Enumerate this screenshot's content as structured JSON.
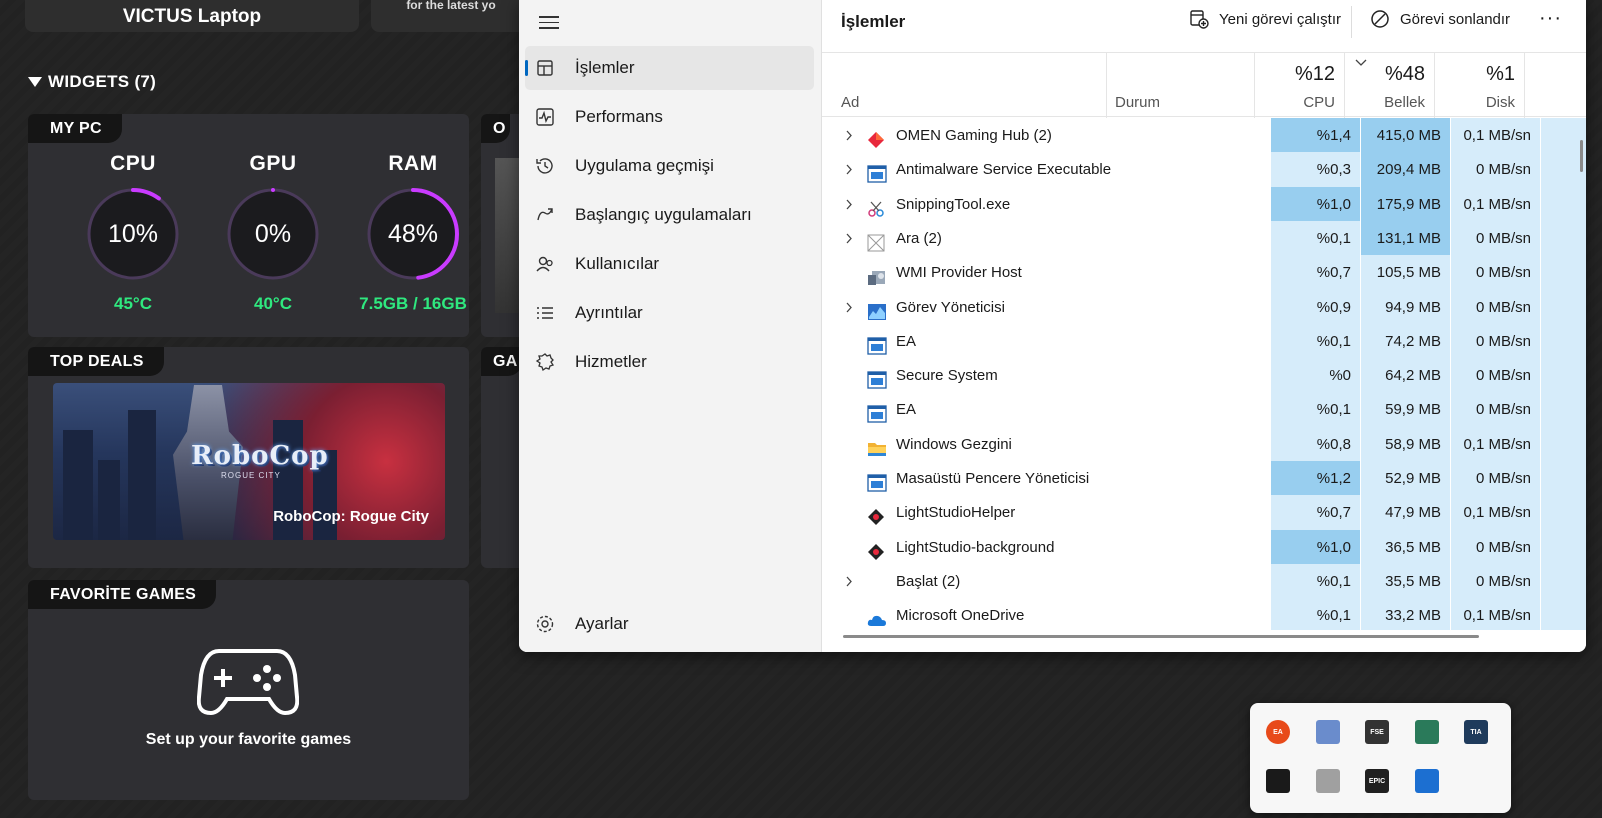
{
  "omen": {
    "device_name": "VICTUS Laptop",
    "promo_text": "for the latest yo",
    "widgets_title": "WIDGETS (7)",
    "mypc": {
      "title": "MY PC",
      "gauges": [
        {
          "label": "CPU",
          "value": "10%",
          "sub": "45°C",
          "level": 0.1
        },
        {
          "label": "GPU",
          "value": "0%",
          "sub": "40°C",
          "level": 0.0
        },
        {
          "label": "RAM",
          "value": "48%",
          "sub": "7.5GB / 16GB",
          "level": 0.48
        }
      ]
    },
    "oc_title": "O",
    "top_deals": {
      "title": "TOP DEALS",
      "logo": "RoboCop",
      "logo_sub": "ROGUE CITY",
      "game": "RoboCop: Rogue City"
    },
    "ga_title": "GA",
    "favorite_games": {
      "title": "FAVORİTE GAMES",
      "text": "Set up your favorite games",
      "icon": "gamepad-icon"
    }
  },
  "taskmgr": {
    "nav": {
      "items": [
        {
          "label": "İşlemler",
          "icon": "processes-icon"
        },
        {
          "label": "Performans",
          "icon": "performance-icon"
        },
        {
          "label": "Uygulama geçmişi",
          "icon": "history-icon"
        },
        {
          "label": "Başlangıç uygulamaları",
          "icon": "startup-icon"
        },
        {
          "label": "Kullanıcılar",
          "icon": "users-icon"
        },
        {
          "label": "Ayrıntılar",
          "icon": "details-icon"
        },
        {
          "label": "Hizmetler",
          "icon": "services-icon"
        }
      ],
      "settings": "Ayarlar"
    },
    "title": "İşlemler",
    "toolbar": {
      "run_new": "Yeni görevi çalıştır",
      "end_task": "Görevi sonlandır",
      "more": "···"
    },
    "columns": {
      "name": "Ad",
      "status": "Durum",
      "cpu": {
        "pct": "%12",
        "label": "CPU"
      },
      "memory": {
        "pct": "%48",
        "label": "Bellek"
      },
      "disk": {
        "pct": "%1",
        "label": "Disk"
      }
    },
    "rows": [
      {
        "name": "OMEN Gaming Hub (2)",
        "expand": true,
        "icon": "omen-icon",
        "cpu": "%1,4",
        "mem": "415,0 MB",
        "disk": "0,1 MB/sn",
        "cpu_hi": true,
        "mem_hi": true
      },
      {
        "name": "Antimalware Service Executable",
        "expand": true,
        "icon": "app-window-icon",
        "cpu": "%0,3",
        "mem": "209,4 MB",
        "disk": "0 MB/sn",
        "cpu_hi": false,
        "mem_hi": true
      },
      {
        "name": "SnippingTool.exe",
        "expand": true,
        "icon": "snipping-icon",
        "cpu": "%1,0",
        "mem": "175,9 MB",
        "disk": "0,1 MB/sn",
        "cpu_hi": true,
        "mem_hi": true
      },
      {
        "name": "Ara (2)",
        "expand": true,
        "icon": "search-app-icon",
        "cpu": "%0,1",
        "mem": "131,1 MB",
        "disk": "0 MB/sn",
        "cpu_hi": false,
        "mem_hi": true
      },
      {
        "name": "WMI Provider Host",
        "expand": false,
        "icon": "wmi-icon",
        "cpu": "%0,7",
        "mem": "105,5 MB",
        "disk": "0 MB/sn",
        "cpu_hi": false,
        "mem_hi": false
      },
      {
        "name": "Görev Yöneticisi",
        "expand": true,
        "icon": "taskmgr-icon",
        "cpu": "%0,9",
        "mem": "94,9 MB",
        "disk": "0 MB/sn",
        "cpu_hi": false,
        "mem_hi": false
      },
      {
        "name": "EA",
        "expand": false,
        "icon": "app-window-icon",
        "cpu": "%0,1",
        "mem": "74,2 MB",
        "disk": "0 MB/sn",
        "cpu_hi": false,
        "mem_hi": false
      },
      {
        "name": "Secure System",
        "expand": false,
        "icon": "app-window-icon",
        "cpu": "%0",
        "mem": "64,2 MB",
        "disk": "0 MB/sn",
        "cpu_hi": false,
        "mem_hi": false
      },
      {
        "name": "EA",
        "expand": false,
        "icon": "app-window-icon",
        "cpu": "%0,1",
        "mem": "59,9 MB",
        "disk": "0 MB/sn",
        "cpu_hi": false,
        "mem_hi": false
      },
      {
        "name": "Windows Gezgini",
        "expand": false,
        "icon": "folder-icon",
        "cpu": "%0,8",
        "mem": "58,9 MB",
        "disk": "0,1 MB/sn",
        "cpu_hi": false,
        "mem_hi": false
      },
      {
        "name": "Masaüstü Pencere Yöneticisi",
        "expand": false,
        "icon": "app-window-icon",
        "cpu": "%1,2",
        "mem": "52,9 MB",
        "disk": "0 MB/sn",
        "cpu_hi": true,
        "mem_hi": false
      },
      {
        "name": "LightStudioHelper",
        "expand": false,
        "icon": "lightstudio-icon",
        "cpu": "%0,7",
        "mem": "47,9 MB",
        "disk": "0,1 MB/sn",
        "cpu_hi": false,
        "mem_hi": false
      },
      {
        "name": "LightStudio-background",
        "expand": false,
        "icon": "lightstudio-icon",
        "cpu": "%1,0",
        "mem": "36,5 MB",
        "disk": "0 MB/sn",
        "cpu_hi": true,
        "mem_hi": false
      },
      {
        "name": "Başlat (2)",
        "expand": true,
        "icon": "",
        "cpu": "%0,1",
        "mem": "35,5 MB",
        "disk": "0 MB/sn",
        "cpu_hi": false,
        "mem_hi": false
      },
      {
        "name": "Microsoft OneDrive",
        "expand": false,
        "icon": "onedrive-icon",
        "cpu": "%0,1",
        "mem": "33,2 MB",
        "disk": "0,1 MB/sn",
        "cpu_hi": false,
        "mem_hi": false
      }
    ]
  },
  "tray": {
    "icons": [
      {
        "name": "ea-tray-icon",
        "label": "EA",
        "color": "#e84a1a"
      },
      {
        "name": "print-tray-icon",
        "label": "",
        "color": "#6a8ccc"
      },
      {
        "name": "fse-tray-icon",
        "label": "FSE",
        "color": "#333333"
      },
      {
        "name": "snipping-tray-icon",
        "label": "",
        "color": "#2a7a5a"
      },
      {
        "name": "tia-tray-icon",
        "label": "TIA",
        "color": "#1f3b5c"
      },
      {
        "name": "nvidia-tray-icon",
        "label": "",
        "color": "#1a1a1a"
      },
      {
        "name": "message-tray-icon",
        "label": "",
        "color": "#a0a0a0"
      },
      {
        "name": "epic-tray-icon",
        "label": "EPIC",
        "color": "#202020"
      },
      {
        "name": "defender-tray-icon",
        "label": "",
        "color": "#1c6fd1"
      }
    ]
  },
  "colors": {
    "cpu_high": "#98ceef",
    "cpu_low": "#d6ecfa",
    "accent": "#0067c0",
    "temp_green": "#2fe87f",
    "gauge_purple": "#c93bff"
  }
}
